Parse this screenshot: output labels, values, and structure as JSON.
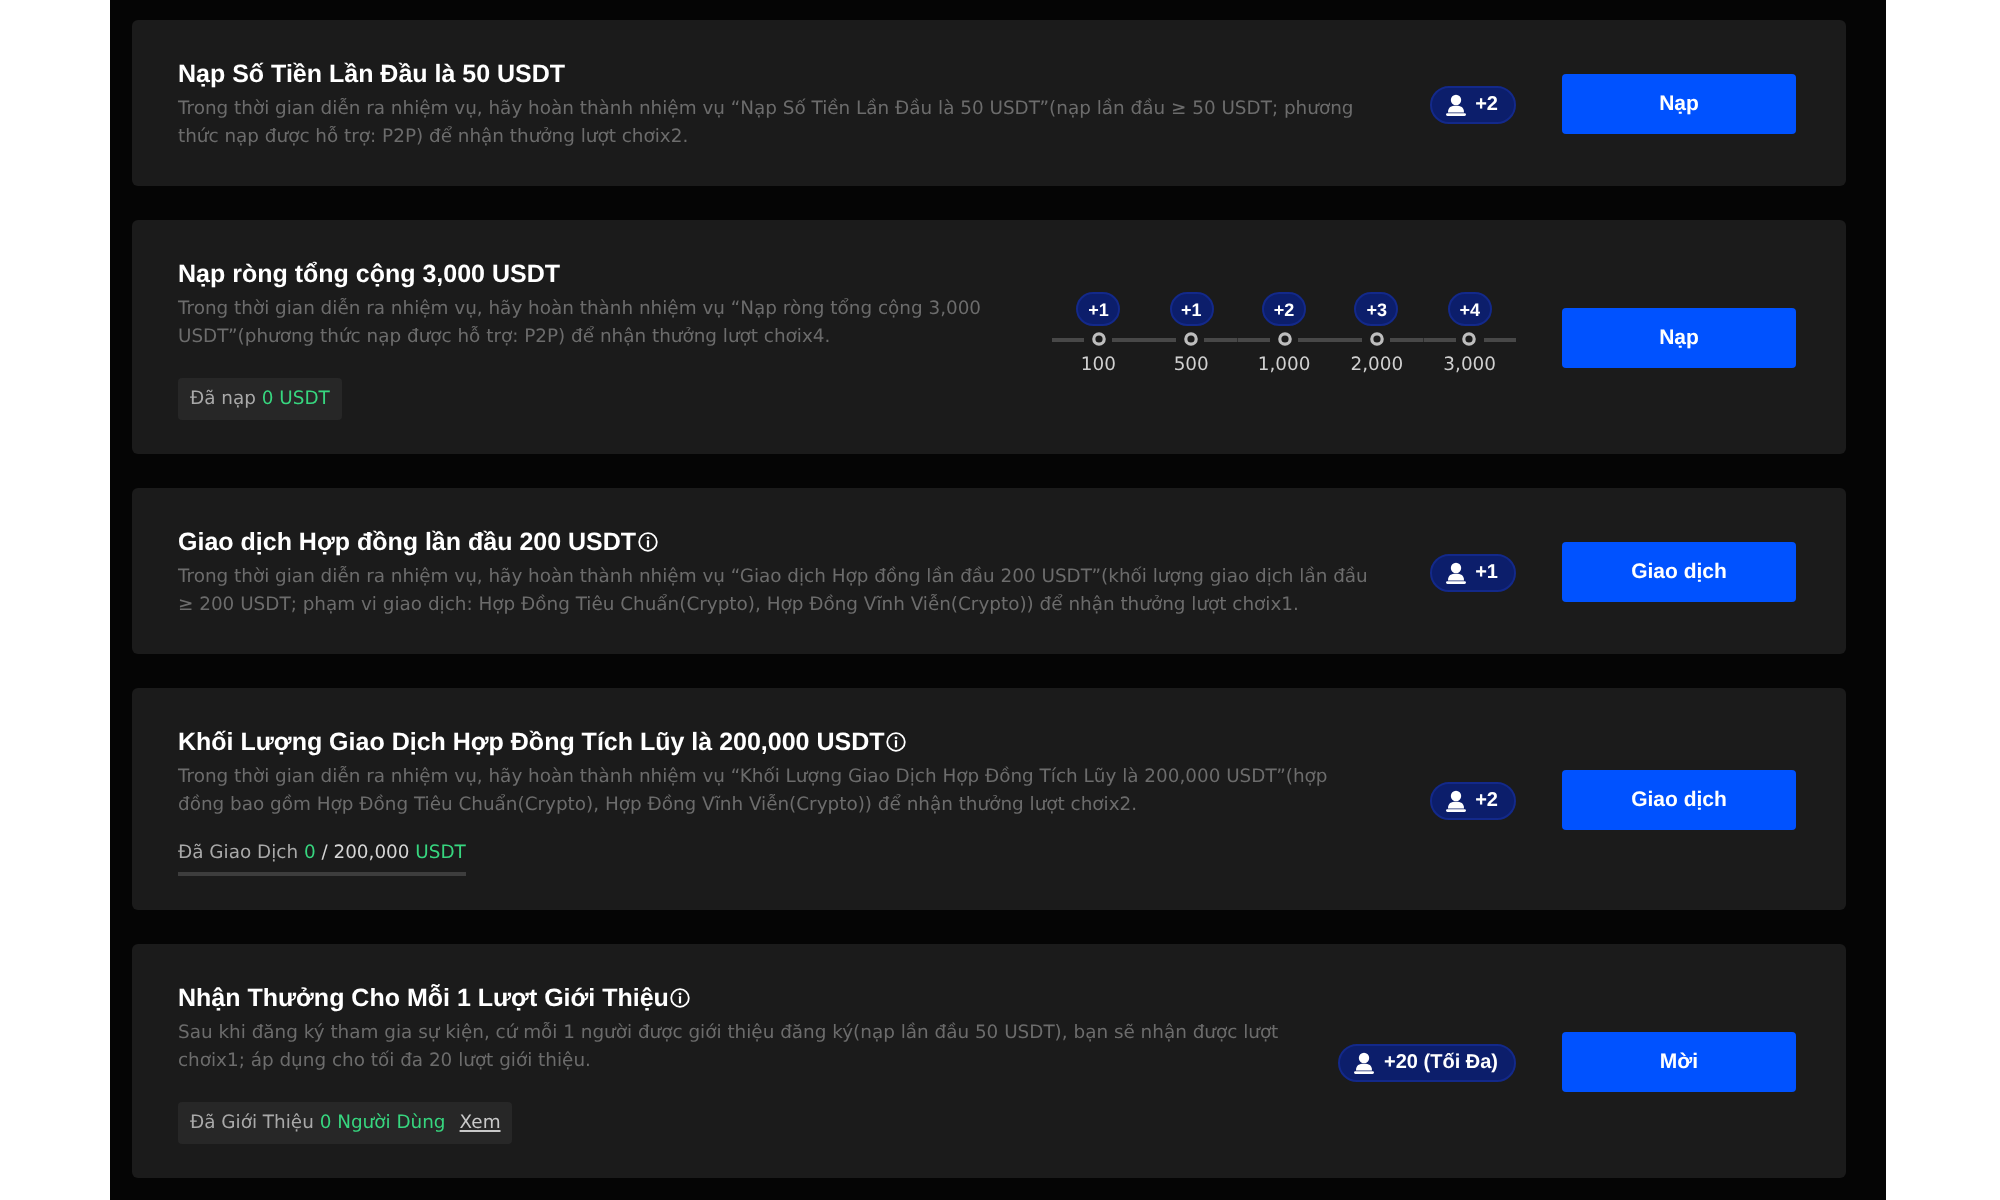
{
  "tasks": [
    {
      "title": "Nạp Số Tiền Lần Đầu là 50 USDT",
      "info": false,
      "description": "Trong thời gian diễn ra nhiệm vụ, hãy hoàn thành nhiệm vụ “Nạp Số Tiền Lần Đầu là 50 USDT”(nạp lần đầu ≥ 50 USDT; phương thức nạp được hỗ trợ: P2P) để nhận thưởng lượt chơix2.",
      "reward": {
        "kind": "badge",
        "label": "+2"
      },
      "button": "Nạp"
    },
    {
      "title": "Nạp ròng tổng cộng 3,000 USDT",
      "info": false,
      "description": "Trong thời gian diễn ra nhiệm vụ, hãy hoàn thành nhiệm vụ “Nạp ròng tổng cộng 3,000 USDT”(phương thức nạp được hỗ trợ: P2P) để nhận thưởng lượt chơix4.",
      "progress": {
        "kind": "chip",
        "label": "Đã nạp",
        "value": "0 USDT"
      },
      "reward": {
        "kind": "milestones",
        "steps": [
          {
            "bonus": "+1",
            "amount": "100"
          },
          {
            "bonus": "+1",
            "amount": "500"
          },
          {
            "bonus": "+2",
            "amount": "1,000"
          },
          {
            "bonus": "+3",
            "amount": "2,000"
          },
          {
            "bonus": "+4",
            "amount": "3,000"
          }
        ]
      },
      "button": "Nạp"
    },
    {
      "title": "Giao dịch Hợp đồng lần đầu 200 USDT",
      "info": true,
      "description": "Trong thời gian diễn ra nhiệm vụ, hãy hoàn thành nhiệm vụ “Giao dịch Hợp đồng lần đầu 200 USDT”(khối lượng giao dịch lần đầu ≥ 200 USDT; phạm vi giao dịch: Hợp Đồng Tiêu Chuẩn(Crypto), Hợp Đồng Vĩnh Viễn(Crypto)) để nhận thưởng lượt chơix1.",
      "reward": {
        "kind": "badge",
        "label": "+1"
      },
      "button": "Giao dịch"
    },
    {
      "title": "Khối Lượng Giao Dịch Hợp Đồng Tích Lũy là 200,000 USDT",
      "info": true,
      "description": "Trong thời gian diễn ra nhiệm vụ, hãy hoàn thành nhiệm vụ “Khối Lượng Giao Dịch Hợp Đồng Tích Lũy là 200,000 USDT”(hợp đồng bao gồm Hợp Đồng Tiêu Chuẩn(Crypto), Hợp Đồng Vĩnh Viễn(Crypto)) để nhận thưởng lượt chơix2.",
      "progress": {
        "kind": "bar",
        "label": "Đã Giao Dịch",
        "value": "0",
        "target": "/ 200,000",
        "unit": "USDT",
        "level": 0
      },
      "reward": {
        "kind": "badge",
        "label": "+2"
      },
      "button": "Giao dịch"
    },
    {
      "title": "Nhận Thưởng Cho Mỗi 1 Lượt Giới Thiệu",
      "info": true,
      "description": "Sau khi đăng ký tham gia sự kiện, cứ mỗi 1 người được giới thiệu đăng ký(nạp lần đầu 50 USDT), bạn sẽ nhận được lượt chơix1; áp dụng cho tối đa 20 lượt giới thiệu.",
      "progress": {
        "kind": "chip",
        "label": "Đã Giới Thiệu",
        "value": "0 Người Dùng",
        "link": "Xem"
      },
      "reward": {
        "kind": "badge",
        "label": "+20 (Tối Đa)"
      },
      "button": "Mời"
    }
  ]
}
